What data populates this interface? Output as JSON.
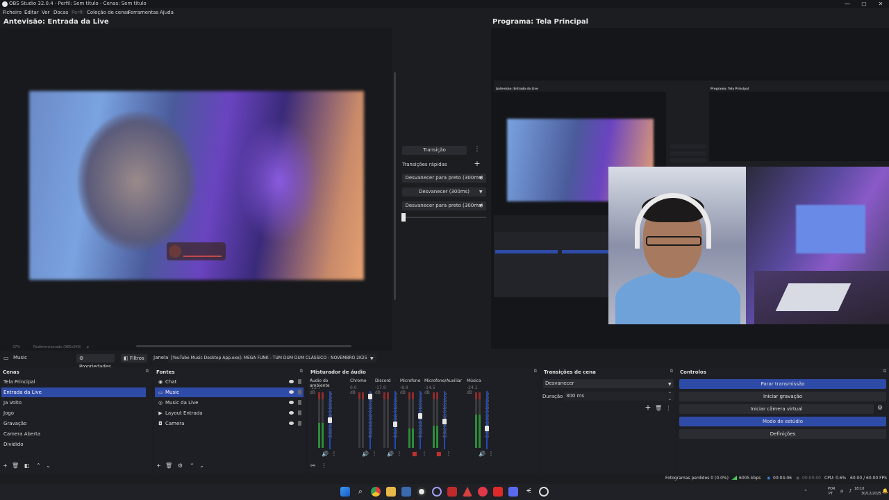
{
  "window": {
    "title": "OBS Studio 32.0.4 - Perfil: Sem título - Cenas: Sem título",
    "controls": [
      "—",
      "▢",
      "✕"
    ]
  },
  "menu": [
    "Ficheiro",
    "Editar",
    "Ver",
    "Docas",
    "Perfil",
    "Coleção de cenas",
    "Ferramentas",
    "Ajuda"
  ],
  "preview": {
    "title": "Antevisão: Entrada da Live",
    "zoom": "37%",
    "resize": "Redimensionado (965x543)"
  },
  "program": {
    "title": "Programa: Tela Principal",
    "mini_preview_title": "Antevisão: Entrada da Live",
    "mini_program_title": "Programa: Tela Principal"
  },
  "transitions_center": {
    "transition_button": "Transição",
    "quick_label": "Transições rápidas",
    "quick_items": [
      "Desvanecer para preto (300ms)",
      "Desvanecer (300ms)",
      "Desvanecer para preto (300ms)"
    ]
  },
  "source_toolbar": {
    "source_name": "Music",
    "properties": "Propriedades",
    "filters": "Filtros",
    "window_label": "Janela",
    "window_value": "[YouTube Music Desktop App.exe]: MEGA FUNK - TUM DUM DUM CLÁSSICO - NOVEMBRO 2K25"
  },
  "scenes": {
    "title": "Cenas",
    "items": [
      "Tela Principal",
      "Entrada da Live",
      "Ja Volto",
      "Jogo",
      "Gravação",
      "Camera Aberta",
      "Dividido"
    ],
    "selected": "Entrada da Live"
  },
  "sources": {
    "title": "Fontes",
    "items": [
      {
        "label": "Chat",
        "icon": "browser-icon"
      },
      {
        "label": "Music",
        "icon": "window-capture-icon"
      },
      {
        "label": "Music da Live",
        "icon": "media-icon"
      },
      {
        "label": "Layout Entrada",
        "icon": "image-icon"
      },
      {
        "label": "Camera",
        "icon": "camera-icon"
      }
    ],
    "selected": "Music"
  },
  "mixer": {
    "title": "Misturador de áudio",
    "channels": [
      {
        "name": "Áudio do ambiente",
        "db": "-12.7 dB",
        "level": 0.45,
        "fader": 0.55,
        "muted": false
      },
      {
        "name": "Chrome",
        "db": "0.0 dB",
        "level": 0.0,
        "fader": 0.95,
        "muted": false
      },
      {
        "name": "Discord",
        "db": "-17.9 dB",
        "level": 0.0,
        "fader": 0.48,
        "muted": false
      },
      {
        "name": "Microfone",
        "db": "-8.9 dB",
        "level": 0.35,
        "fader": 0.62,
        "muted": true
      },
      {
        "name": "Microfone/Auxiliar",
        "db": "-14.5 dB",
        "level": 0.4,
        "fader": 0.52,
        "muted": true
      },
      {
        "name": "Música",
        "db": "-24.1 dB",
        "level": 0.6,
        "fader": 0.4,
        "muted": false
      }
    ],
    "scale": [
      "0",
      "-5",
      "-10",
      "-15",
      "-20",
      "-25",
      "-30",
      "-35",
      "-40",
      "-45",
      "-50",
      "-55",
      "-60"
    ]
  },
  "scene_transitions": {
    "title": "Transições de cena",
    "type": "Desvanecer",
    "duration_label": "Duração",
    "duration_value": "300 ms"
  },
  "controls": {
    "title": "Controlos",
    "buttons": [
      "Parar transmissão",
      "Iniciar gravação",
      "Iniciar câmera virtual",
      "Modo de estúdio",
      "Definições"
    ]
  },
  "status": {
    "dropped": "Fotogramas perdidos 0 (0.0%)",
    "bitrate": "6005 kbps",
    "live_time": "00:04:06",
    "rec_time": "00:00:00",
    "cpu": "CPU: 0.6%",
    "fps": "60.00 / 60.00 FPS"
  },
  "taskbar": {
    "lang_top": "POR",
    "lang_bottom": "PT",
    "time": "18:10",
    "date": "30/12/2025"
  },
  "colors": {
    "accent": "#2f4ba8",
    "background": "#1c1d21",
    "panel": "#1e1f24"
  }
}
